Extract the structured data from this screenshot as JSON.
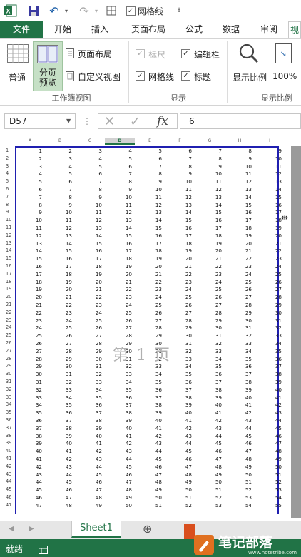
{
  "qat": {
    "undo_label": "↶",
    "redo_label": "↷",
    "gridlines_label": "网格线",
    "more_label": "⇟"
  },
  "tabs": [
    {
      "label": "文件",
      "active": true
    },
    {
      "label": "开始"
    },
    {
      "label": "插入"
    },
    {
      "label": "页面布局"
    },
    {
      "label": "公式"
    },
    {
      "label": "数据"
    },
    {
      "label": "审阅"
    },
    {
      "label": "视"
    }
  ],
  "ribbon": {
    "normal": "普通",
    "page_break_preview": "分页\n预览",
    "page_layout": "页面布局",
    "custom_view": "自定义视图",
    "group_workbook_views": "工作簿视图",
    "ruler": "标尺",
    "formula_bar": "编辑栏",
    "gridlines": "网格线",
    "headings": "标题",
    "group_show": "显示",
    "zoom": "显示比例",
    "zoom_100": "100%",
    "group_zoom": "显示比例"
  },
  "formula": {
    "name_box": "D57",
    "cancel": "✕",
    "enter": "✓",
    "fx": "fx",
    "value": "6"
  },
  "sheet": {
    "columns": [
      "A",
      "B",
      "C",
      "D",
      "E",
      "F",
      "G",
      "H",
      "I"
    ],
    "active_column": "D",
    "watermark": "第 1 页",
    "rows_count": 47
  },
  "sheet_tabs": {
    "active": "Sheet1",
    "add": "⊕"
  },
  "status": {
    "ready": "就绪"
  },
  "brand": {
    "name": "笔记部落",
    "url": "www.notetribe.com"
  },
  "colors": {
    "excel_green": "#217346",
    "grid_border": "#1f1fb0",
    "tab_active_bg": "#217346"
  }
}
